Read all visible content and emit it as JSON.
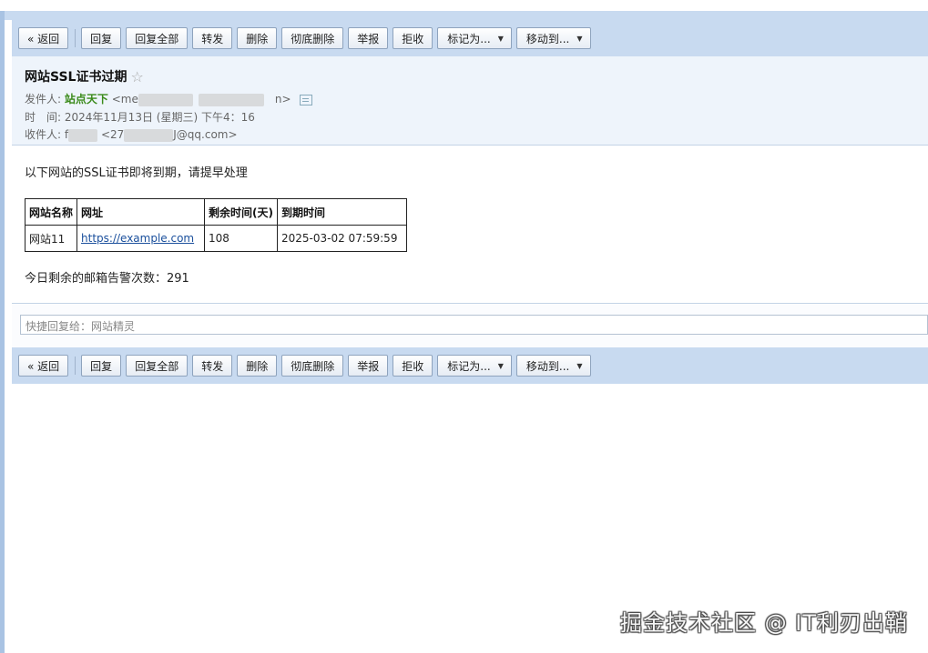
{
  "toolbar": {
    "back": "« 返回",
    "reply": "回复",
    "reply_all": "回复全部",
    "forward": "转发",
    "delete": "删除",
    "delete_forever": "彻底删除",
    "report": "举报",
    "reject": "拒收",
    "mark_as": "标记为...",
    "move_to": "移动到...",
    "caret": "▼"
  },
  "email": {
    "subject": "网站SSL证书过期",
    "star": "☆",
    "from_label": "发件人:",
    "from_name": "站点天下",
    "from_addr_start": "<me",
    "from_addr_end": "n>",
    "time_label": "时　间:",
    "time_value": "2024年11月13日 (星期三) 下午4：16",
    "to_label": "收件人:",
    "to_name_start": "f",
    "to_addr_start": "<27",
    "to_addr_end": "J@qq.com>"
  },
  "body": {
    "intro": "以下网站的SSL证书即将到期，请提早处理",
    "table": {
      "headers": [
        "网站名称",
        "网址",
        "剩余时间(天)",
        "到期时间"
      ],
      "row": {
        "name": "网站11",
        "url": "https://example.com",
        "days": "108",
        "expiry": "2025-03-02 07:59:59"
      }
    },
    "remaining": "今日剩余的邮箱告警次数：291"
  },
  "quick_reply": {
    "placeholder": "快捷回复给：网站精灵"
  },
  "watermark": "掘金技术社区 @ IT利刃出鞘"
}
